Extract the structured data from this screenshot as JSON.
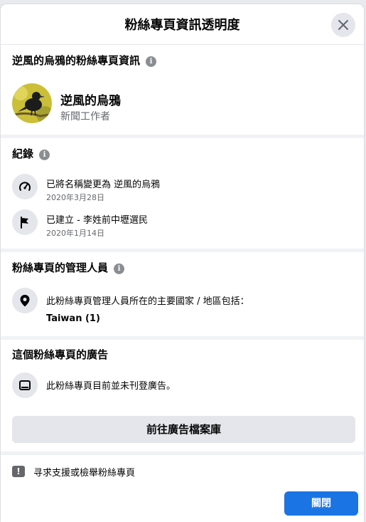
{
  "dialog": {
    "title": "粉絲專頁資訊透明度",
    "close_icon": "close-icon"
  },
  "page_info": {
    "section_title": "逆風的烏鴉的粉絲專頁資訊",
    "info_icon": "i",
    "page_name": "逆風的烏鴉",
    "category": "新聞工作者"
  },
  "history": {
    "section_title": "紀錄",
    "info_icon": "i",
    "items": [
      {
        "text": "已將名稱變更為 逆風的烏鴉",
        "date": "2020年3月28日",
        "icon": "speedometer-icon"
      },
      {
        "text": "已建立 - 李姓前中壢選民",
        "date": "2020年1月14日",
        "icon": "flag-icon"
      }
    ]
  },
  "managers": {
    "section_title": "粉絲專頁的管理人員",
    "info_icon": "i",
    "location_text": "此粉絲專頁管理人員所在的主要國家 / 地區包括：",
    "country": "Taiwan (1)"
  },
  "ads": {
    "section_title": "這個粉絲專頁的廣告",
    "status_text": "此粉絲專頁目前並未刊登廣告。",
    "ad_library_button": "前往廣告檔案庫"
  },
  "footer": {
    "report_icon": "!",
    "report_link": "寻求支援或檢舉粉絲專頁",
    "close_button": "關閉"
  },
  "background": {
    "partial_text": "        "
  },
  "colors": {
    "primary_button": "#1b74e4",
    "secondary_button": "#e4e6eb",
    "divider": "#f0f2f5",
    "muted_text": "#65676b"
  }
}
